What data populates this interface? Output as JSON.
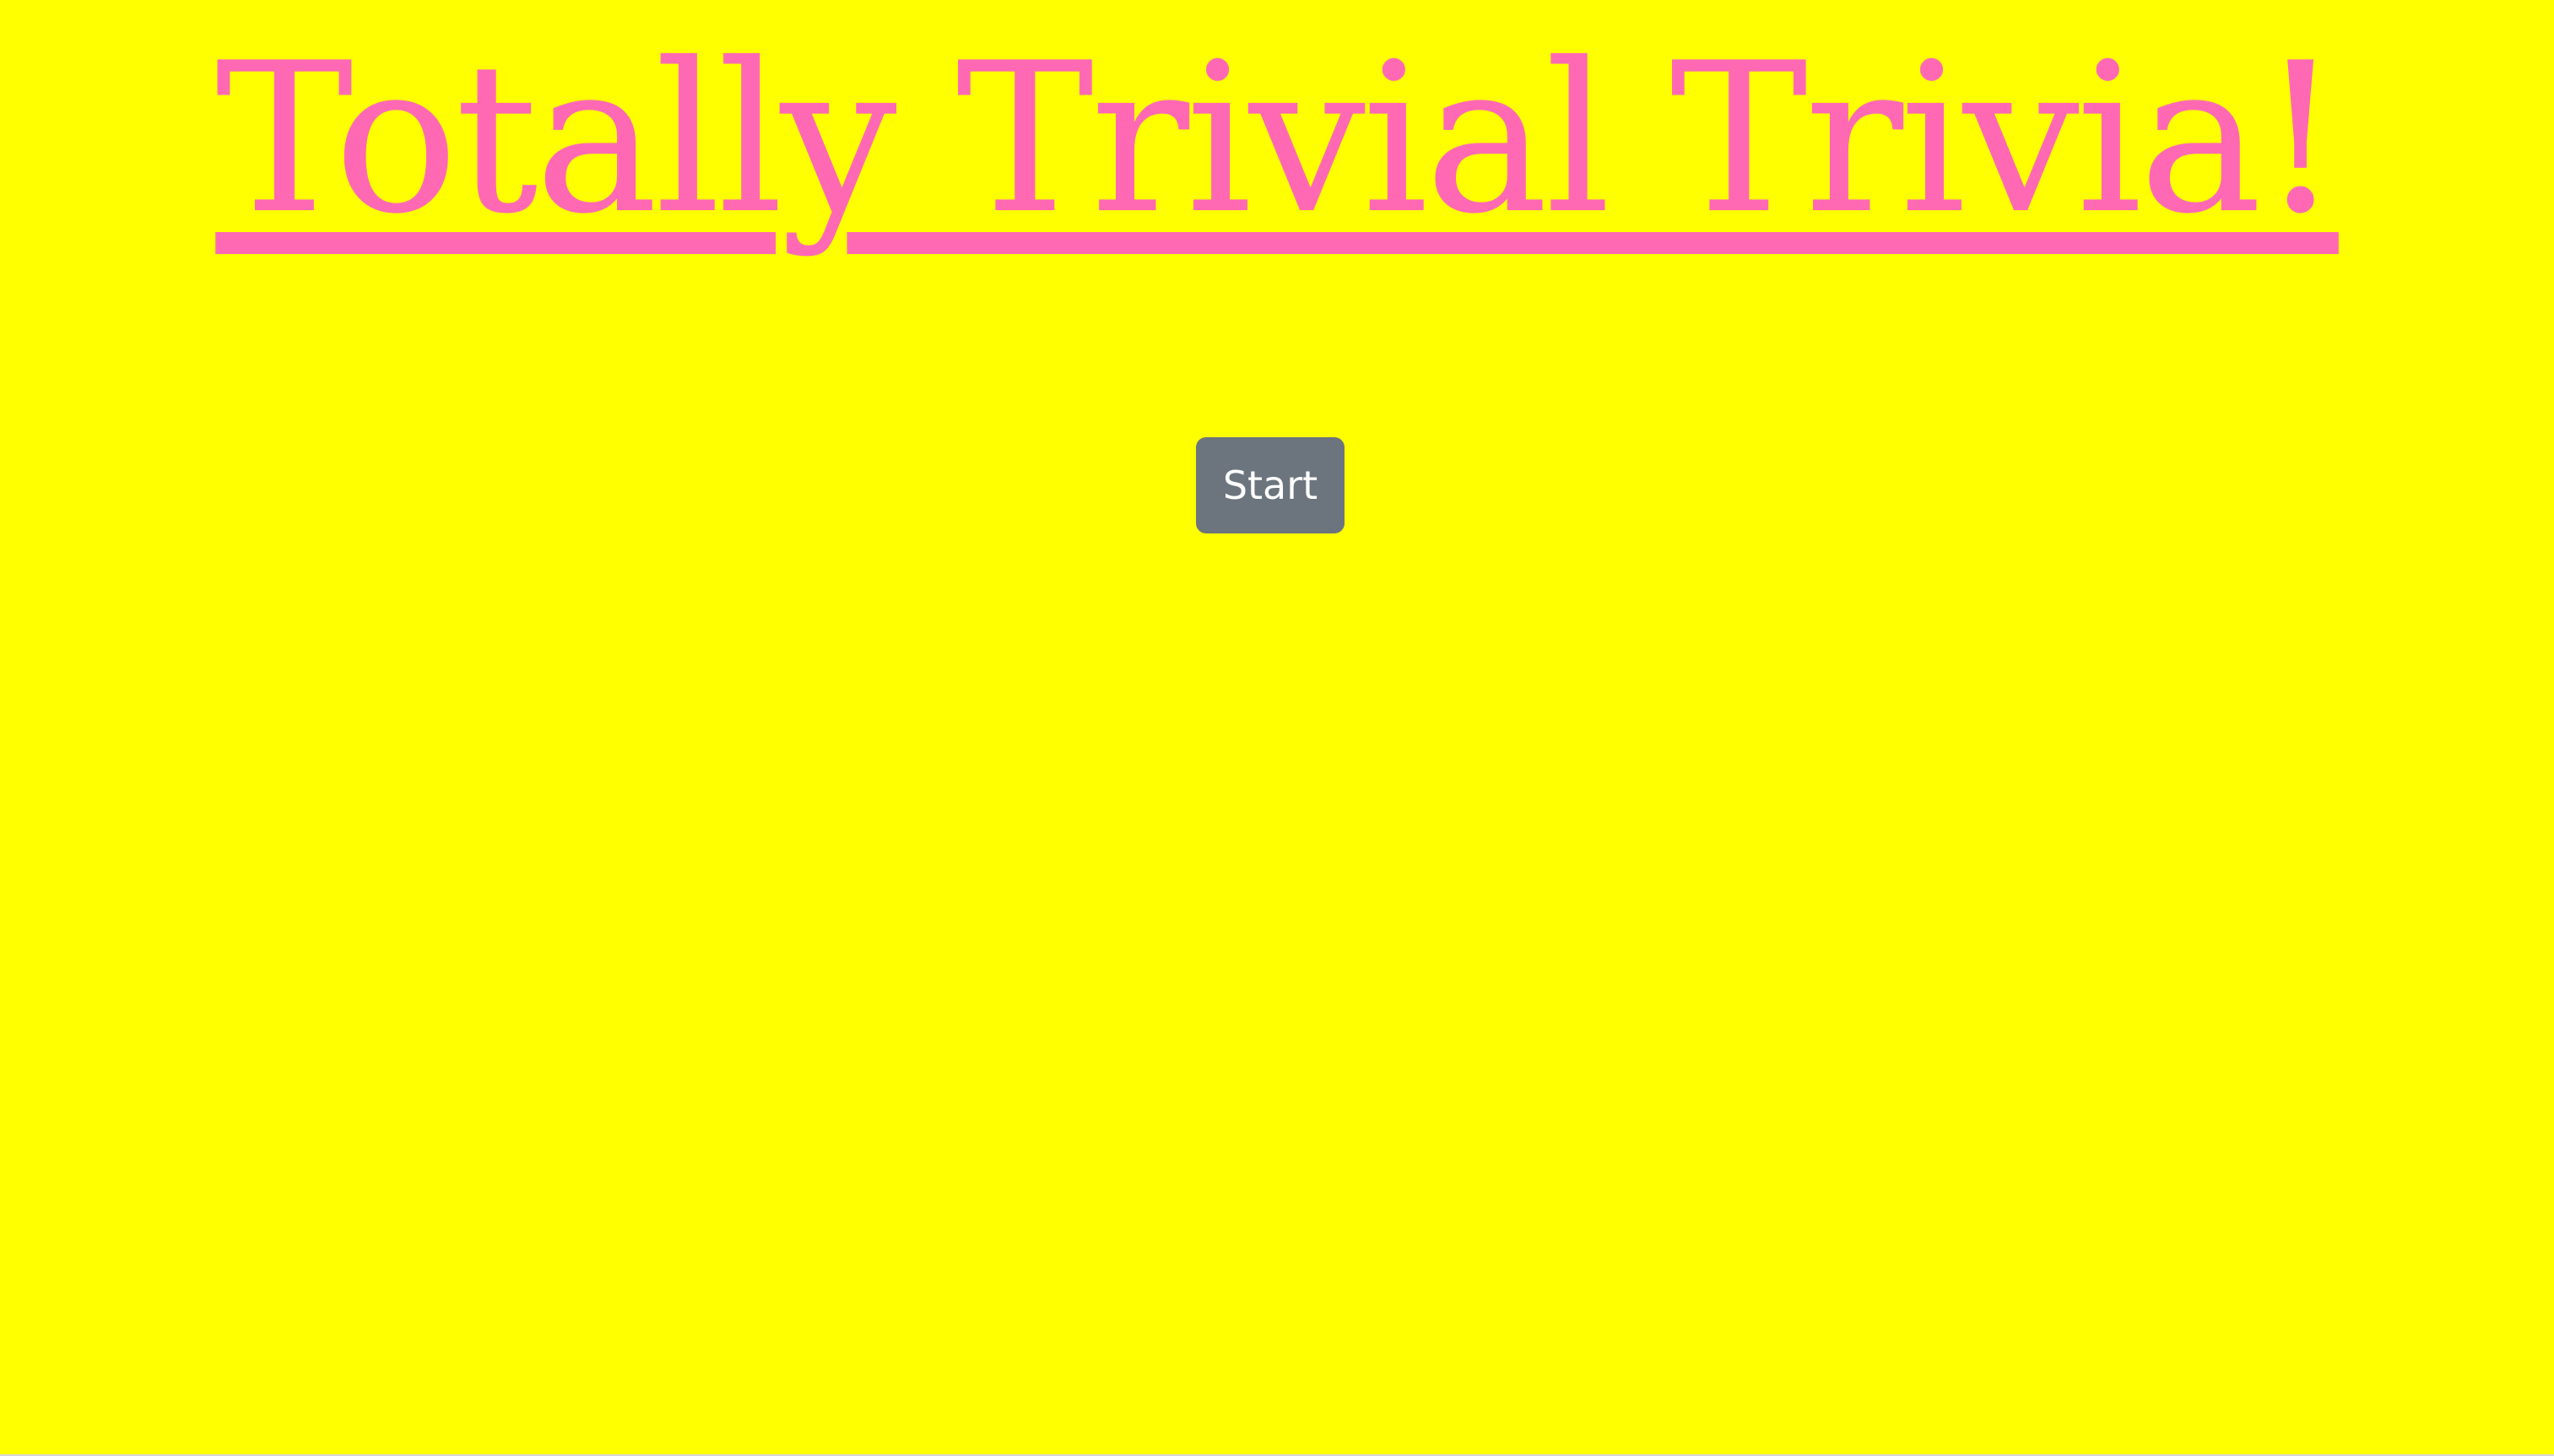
{
  "header": {
    "title": "Totally Trivial Trivia!"
  },
  "main": {
    "start_label": "Start"
  },
  "colors": {
    "background": "#ffff00",
    "title": "#ff69b4",
    "button": "#6c757d",
    "button_text": "#ffffff"
  }
}
